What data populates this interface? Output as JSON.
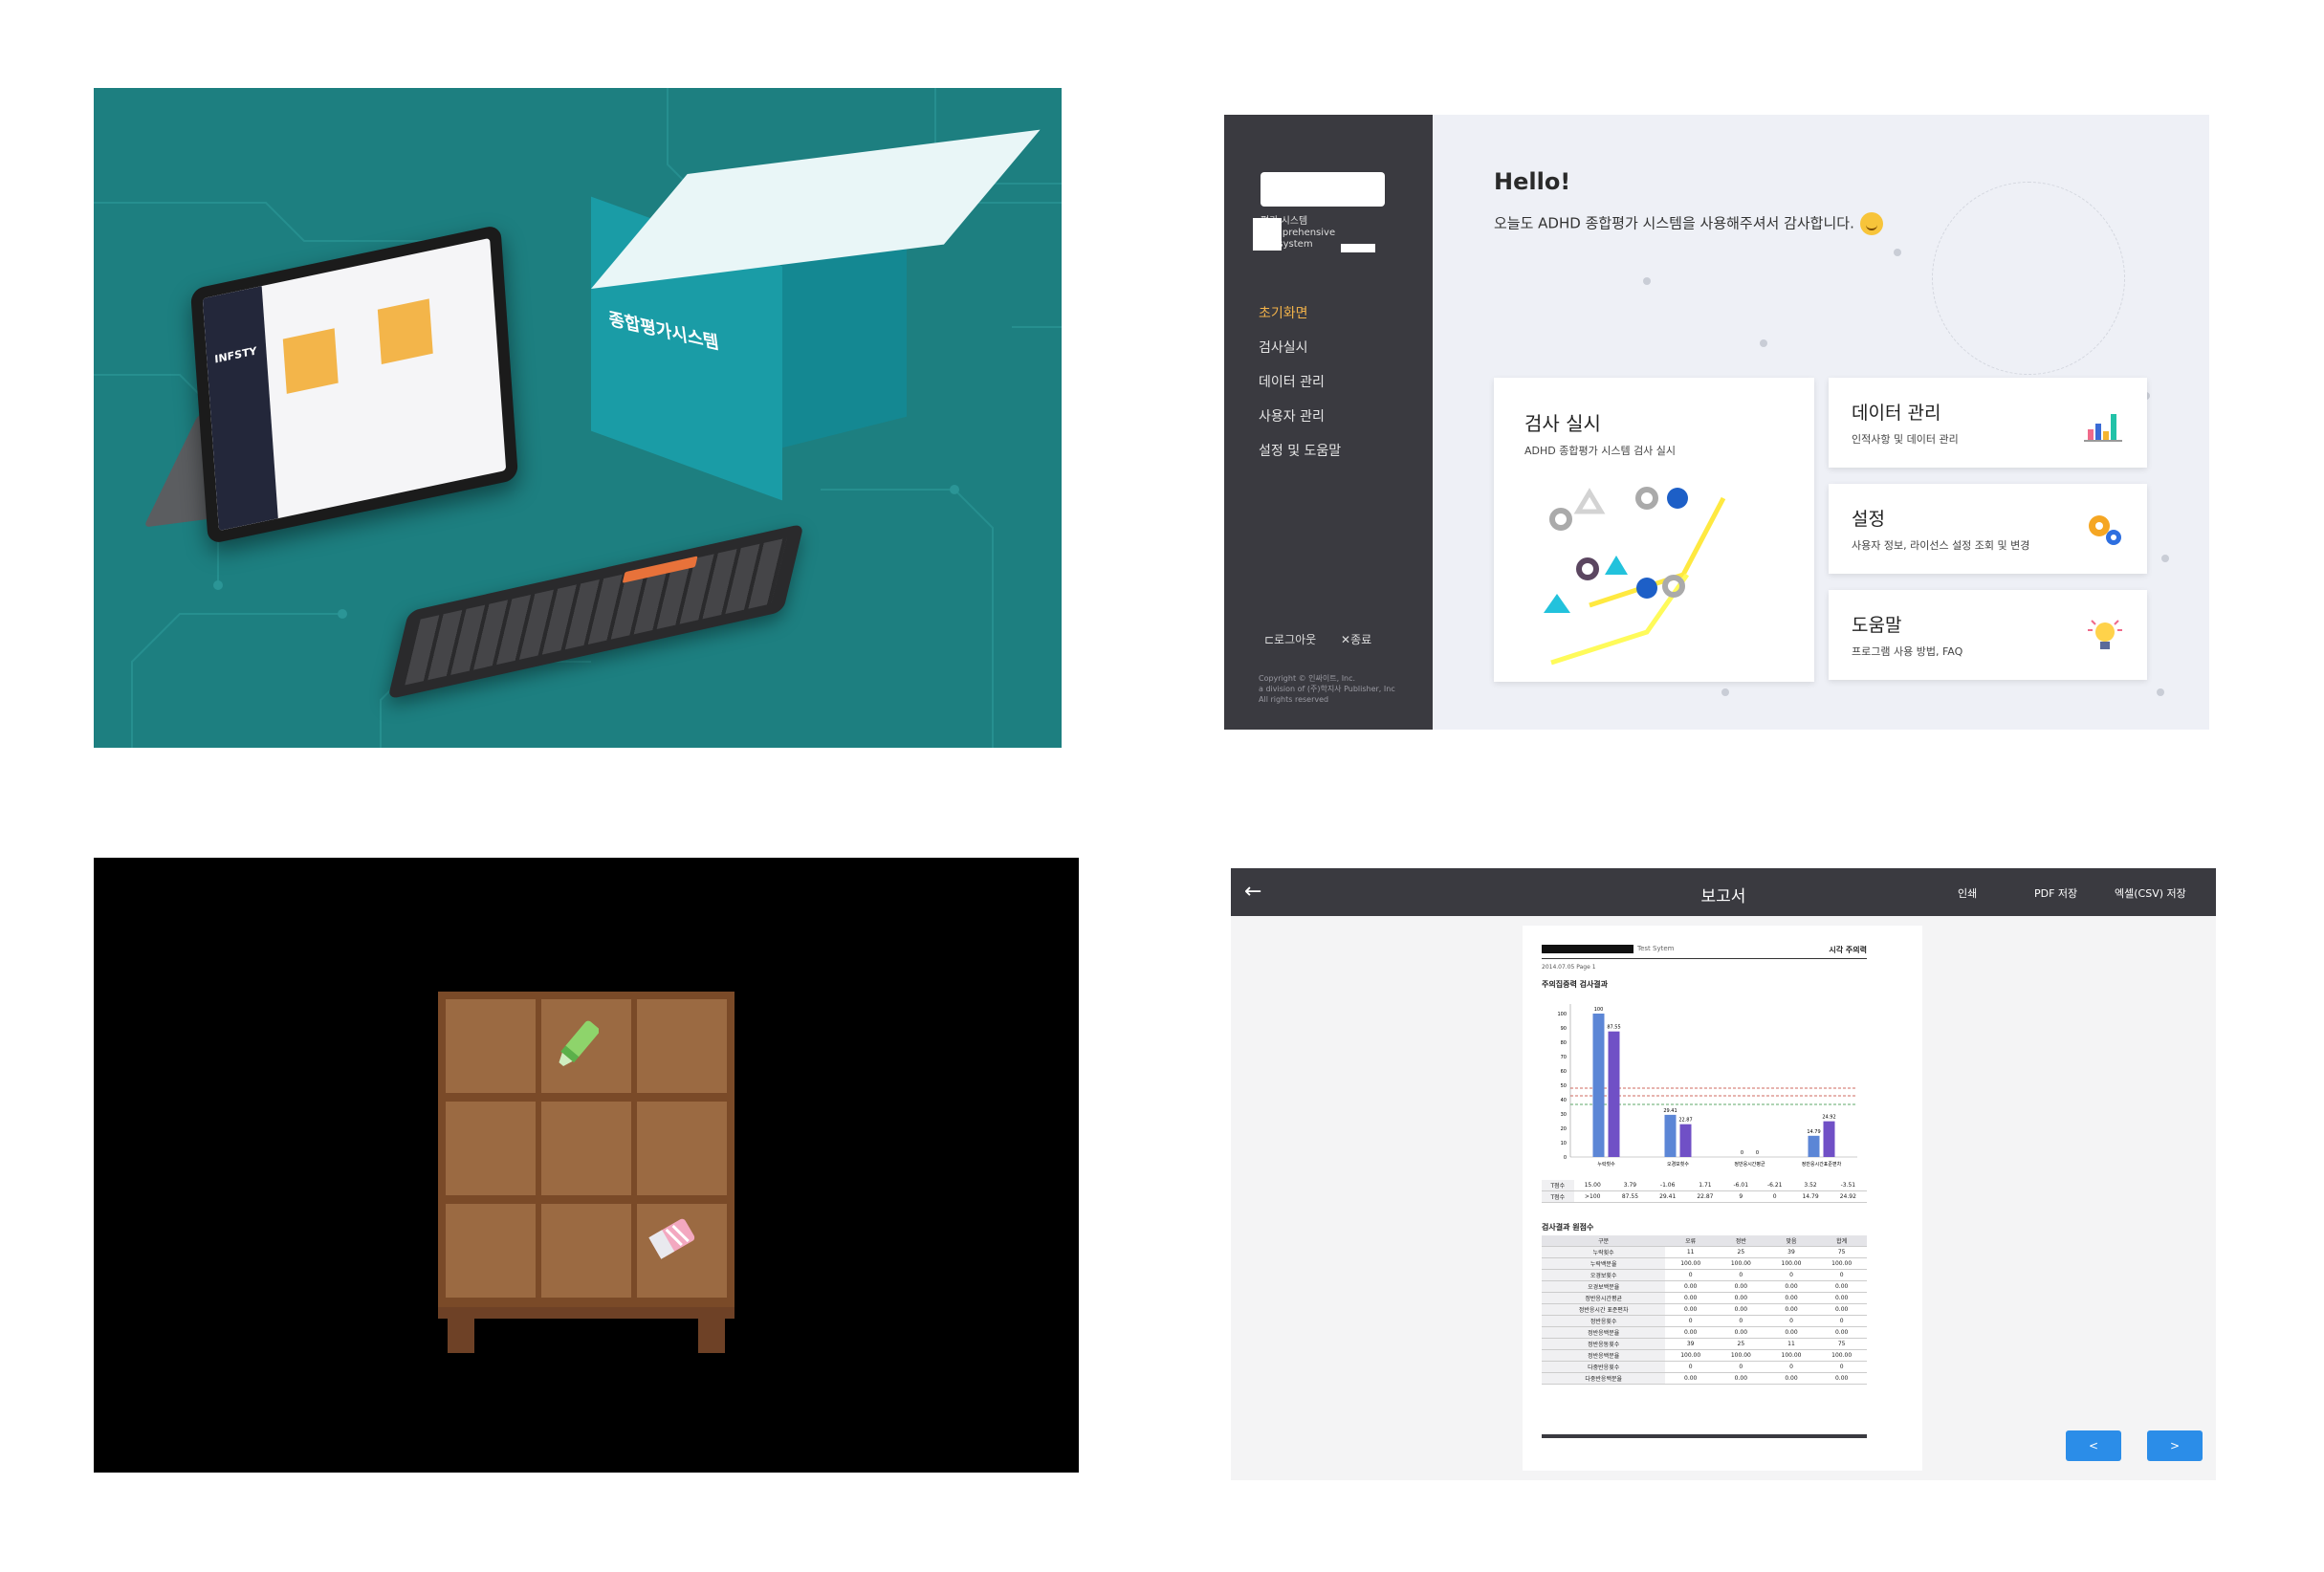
{
  "product_photo": {
    "tablet_brand": "INFSTY",
    "box_title": "종합평가시스템"
  },
  "app_home": {
    "sidebar": {
      "logo_lines": [
        "평가 시스템",
        "Comprehensive",
        "ion system"
      ],
      "items": [
        {
          "label": "초기화면",
          "active": true
        },
        {
          "label": "검사실시"
        },
        {
          "label": "데이터 관리"
        },
        {
          "label": "사용자 관리"
        },
        {
          "label": "설정 및 도움말"
        }
      ],
      "logout_label": "⊏로그아웃",
      "exit_label": "✕종료",
      "copyright": [
        "Copyright © 인싸이트, Inc.",
        "a division of (주)학지사 Publisher, Inc",
        "All rights reserved"
      ]
    },
    "greeting": "Hello!",
    "subtitle": "오늘도 ADHD 종합평가 시스템을 사용해주셔서 감사합니다.",
    "cards": {
      "test": {
        "title": "검사 실시",
        "desc": "ADHD 종합평가 시스템 검사 실시"
      },
      "data": {
        "title": "데이터 관리",
        "desc": "인적사항 및 데이터 관리"
      },
      "settings": {
        "title": "설정",
        "desc": "사용자 정보, 라이선스 설정 조회 및 변경"
      },
      "help": {
        "title": "도움말",
        "desc": "프로그램 사용 방법, FAQ"
      }
    }
  },
  "game": {
    "items": [
      "green-marker",
      "pink-eraser"
    ]
  },
  "report": {
    "title": "보고서",
    "actions": {
      "print": "인쇄",
      "pdf": "PDF 저장",
      "csv": "엑셀(CSV) 저장"
    },
    "page": {
      "header_mid": "Test Sytem",
      "header_right": "시각 주의력",
      "header_sub": "2014.07.05  Page 1",
      "section1": "주의집중력 검사결과",
      "section2": "검사결과 원점수"
    },
    "prev_label": "<",
    "next_label": ">",
    "table_rows": [
      [
        "구분",
        "오류",
        "정반",
        "맞음",
        "합계"
      ],
      [
        "누락횟수",
        "11",
        "25",
        "39",
        "75"
      ],
      [
        "누락백분율",
        "100.00",
        "100.00",
        "100.00",
        "100.00"
      ],
      [
        "오경보횟수",
        "0",
        "0",
        "0",
        "0"
      ],
      [
        "오경보백분율",
        "0.00",
        "0.00",
        "0.00",
        "0.00"
      ],
      [
        "정반응시간평균",
        "0.00",
        "0.00",
        "0.00",
        "0.00"
      ],
      [
        "정반응시간 표준편차",
        "0.00",
        "0.00",
        "0.00",
        "0.00"
      ],
      [
        "정반응횟수",
        "0",
        "0",
        "0",
        "0"
      ],
      [
        "정반응백분율",
        "0.00",
        "0.00",
        "0.00",
        "0.00"
      ],
      [
        "정반응동횟수",
        "39",
        "25",
        "11",
        "75"
      ],
      [
        "정반응백분율",
        "100.00",
        "100.00",
        "100.00",
        "100.00"
      ],
      [
        "다중반응횟수",
        "0",
        "0",
        "0",
        "0"
      ],
      [
        "다중반응백분율",
        "0.00",
        "0.00",
        "0.00",
        "0.00"
      ]
    ],
    "score_rows": [
      [
        "T점수",
        "15.00",
        "3.79",
        "-1.06",
        "1.71",
        "-6.01",
        "-6.21",
        "3.52",
        "-3.51"
      ],
      [
        "T점수",
        ">100",
        "87.55",
        "29.41",
        "22.87",
        "9",
        "0",
        "14.79",
        "24.92"
      ]
    ],
    "chart_data": {
      "type": "bar",
      "categories": [
        "누락횟수",
        "오경보횟수",
        "정반응시간평균",
        "정반응시간표준편차"
      ],
      "series": [
        {
          "name": "",
          "values": [
            100,
            29.41,
            0,
            14.79
          ]
        },
        {
          "name": "",
          "values": [
            87.55,
            22.87,
            0,
            24.92
          ]
        }
      ],
      "ylim": [
        0,
        100
      ],
      "colors": [
        "#5c86d6",
        "#7050c6"
      ]
    }
  }
}
